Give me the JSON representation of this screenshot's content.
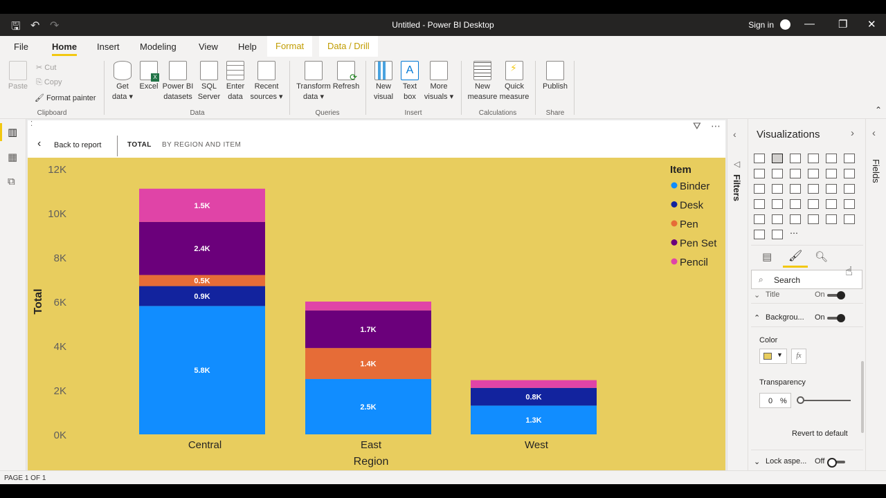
{
  "window": {
    "title": "Untitled - Power BI Desktop",
    "sign_in": "Sign in"
  },
  "menu": {
    "items": [
      "File",
      "Home",
      "Insert",
      "Modeling",
      "View",
      "Help"
    ],
    "context_tabs": [
      "Format",
      "Data / Drill"
    ],
    "active": "Home"
  },
  "ribbon": {
    "clipboard": {
      "paste": "Paste",
      "cut": "Cut",
      "copy": "Copy",
      "format_painter": "Format painter",
      "label": "Clipboard"
    },
    "data": {
      "buttons": [
        {
          "line1": "Get",
          "line2": "data ▾"
        },
        {
          "line1": "Excel",
          "line2": ""
        },
        {
          "line1": "Power BI",
          "line2": "datasets"
        },
        {
          "line1": "SQL",
          "line2": "Server"
        },
        {
          "line1": "Enter",
          "line2": "data"
        },
        {
          "line1": "Recent",
          "line2": "sources ▾"
        }
      ],
      "label": "Data"
    },
    "queries": {
      "buttons": [
        {
          "line1": "Transform",
          "line2": "data ▾"
        },
        {
          "line1": "Refresh",
          "line2": ""
        }
      ],
      "label": "Queries"
    },
    "insert": {
      "buttons": [
        {
          "line1": "New",
          "line2": "visual"
        },
        {
          "line1": "Text",
          "line2": "box"
        },
        {
          "line1": "More",
          "line2": "visuals ▾"
        }
      ],
      "label": "Insert"
    },
    "calculations": {
      "buttons": [
        {
          "line1": "New",
          "line2": "measure"
        },
        {
          "line1": "Quick",
          "line2": "measure"
        }
      ],
      "label": "Calculations"
    },
    "share": {
      "buttons": [
        {
          "line1": "Publish",
          "line2": ""
        }
      ],
      "label": "Share"
    }
  },
  "visual_header": {
    "back": "Back to report",
    "tabs": [
      "TOTAL",
      "BY REGION AND ITEM"
    ]
  },
  "chart_data": {
    "type": "bar",
    "stacked": true,
    "categories": [
      "Central",
      "East",
      "West"
    ],
    "xlabel": "Region",
    "ylabel": "Total",
    "ylim": [
      0,
      12000
    ],
    "yticks": [
      "0K",
      "2K",
      "4K",
      "6K",
      "8K",
      "10K",
      "12K"
    ],
    "legend_title": "Item",
    "legend_position": "top-right",
    "grid": false,
    "background": "#e8cd5e",
    "series": [
      {
        "name": "Binder",
        "color": "#118dff",
        "values": [
          5800,
          2500,
          1300
        ],
        "labels": [
          "5.8K",
          "2.5K",
          "1.3K"
        ]
      },
      {
        "name": "Desk",
        "color": "#12239e",
        "values": [
          900,
          0,
          800
        ],
        "labels": [
          "0.9K",
          "",
          "0.8K"
        ]
      },
      {
        "name": "Pen",
        "color": "#e66c37",
        "values": [
          500,
          1400,
          0
        ],
        "labels": [
          "0.5K",
          "1.4K",
          ""
        ]
      },
      {
        "name": "Pen Set",
        "color": "#6b007b",
        "values": [
          2400,
          1700,
          0
        ],
        "labels": [
          "2.4K",
          "1.7K",
          ""
        ]
      },
      {
        "name": "Pencil",
        "color": "#e044a7",
        "values": [
          1500,
          400,
          350
        ],
        "labels": [
          "1.5K",
          "",
          ""
        ]
      }
    ]
  },
  "panes": {
    "filters": "Filters",
    "visualizations": "Visualizations",
    "fields": "Fields",
    "search_placeholder": "Search",
    "format": {
      "title": "Title",
      "title_state": "On",
      "background": "Backgrou...",
      "background_state": "On",
      "color_label": "Color",
      "color_swatch": "#e8cd5e",
      "fx": "fx",
      "transparency_label": "Transparency",
      "transparency_value": "0",
      "transparency_unit": "%",
      "revert": "Revert to default",
      "lock_aspect": "Lock aspe...",
      "lock_state": "Off"
    }
  },
  "status": {
    "page": "PAGE 1 OF 1"
  }
}
